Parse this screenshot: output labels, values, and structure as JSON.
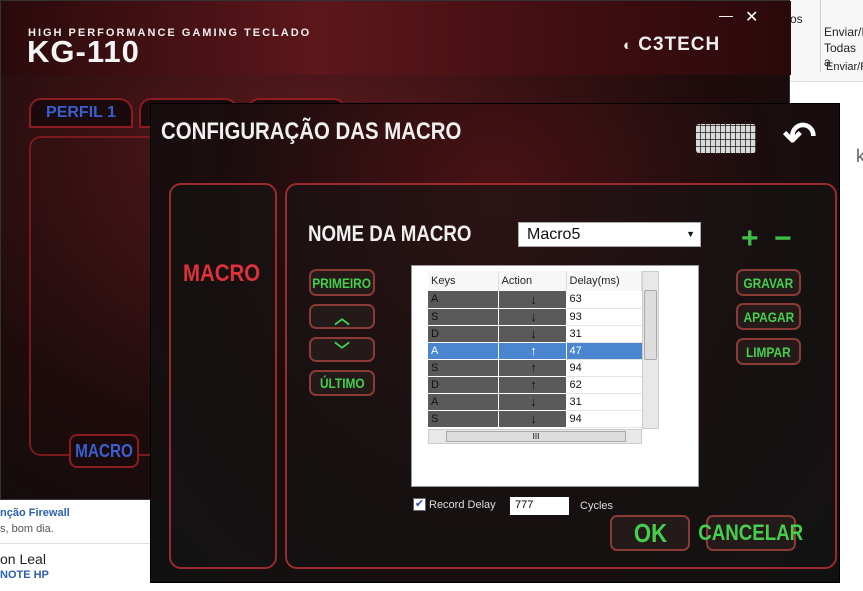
{
  "desktop": {
    "ribbon": [
      "os",
      "Enviar/I",
      "Todas a",
      "Enviar/F"
    ],
    "side_char": "k",
    "feed": [
      {
        "title": "nção Firewall",
        "text": "s, bom dia."
      },
      {
        "title": "on Leal",
        "text": "NOTE HP"
      }
    ]
  },
  "main_window": {
    "tagline": "HIGH PERFORMANCE GAMING TECLADO",
    "product": "KG-110",
    "brand": "C3TECH",
    "minimize": "—",
    "close": "✕",
    "tabs": [
      "PERFIL 1",
      "",
      ""
    ],
    "macro_button": "MACRO"
  },
  "dialog": {
    "title": "CONFIGURAÇÃO DAS MACRO",
    "keyboard_icon": "keyboard-icon",
    "back_icon": "back-arrow-icon",
    "side_label": "MACRO",
    "name_label": "NOME DA MACRO",
    "macro_name": "Macro5",
    "add": "+",
    "remove": "−",
    "nav": {
      "first": "PRIMEIRO",
      "up": "︿",
      "down": "﹀",
      "last": "ÚLTIMO"
    },
    "actions": {
      "record": "GRAVAR",
      "delete": "APAGAR",
      "clear": "LIMPAR"
    },
    "table": {
      "columns": [
        "Keys",
        "Action",
        "Delay(ms)"
      ],
      "rows": [
        [
          "A",
          "↓",
          "63"
        ],
        [
          "S",
          "↓",
          "93"
        ],
        [
          "D",
          "↓",
          "31"
        ],
        [
          "A",
          "↑",
          "47"
        ],
        [
          "S",
          "↑",
          "94"
        ],
        [
          "D",
          "↑",
          "62"
        ],
        [
          "A",
          "↓",
          "31"
        ],
        [
          "S",
          "↓",
          "94"
        ]
      ],
      "selected_row": 3,
      "hscroll_grip": "III"
    },
    "record_delay": {
      "label": "Record Delay",
      "checked": true
    },
    "cycles": {
      "value": "777",
      "label": "Cycles"
    },
    "ok": "OK",
    "cancel": "CANCELAR"
  }
}
